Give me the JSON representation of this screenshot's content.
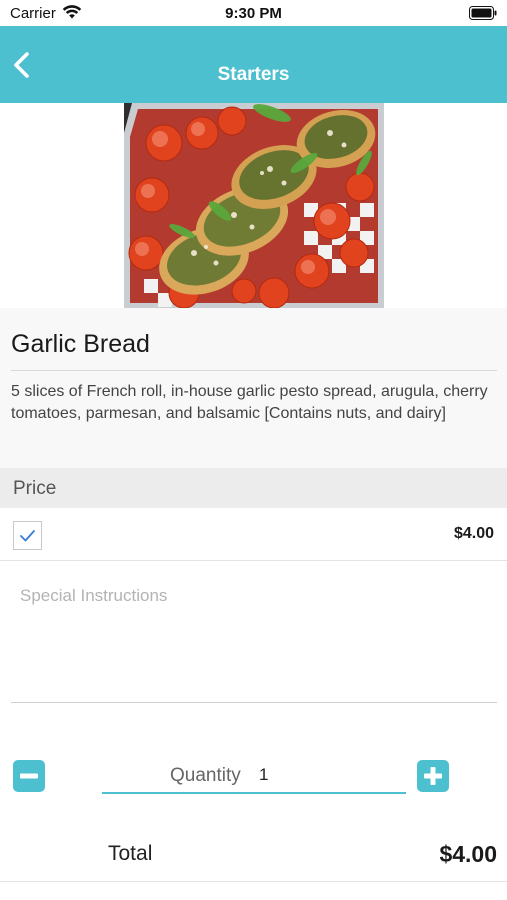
{
  "status_bar": {
    "carrier": "Carrier",
    "time": "9:30 PM"
  },
  "nav": {
    "title": "Starters",
    "back_icon": "chevron-left-icon"
  },
  "item": {
    "name": "Garlic Bread",
    "description": "5 slices of French roll, in-house garlic pesto spread, arugula, cherry tomatoes, parmesan, and balsamic [Contains nuts, and dairy]"
  },
  "price_section": {
    "header": "Price",
    "option_price": "$4.00",
    "option_checked": true
  },
  "instructions": {
    "placeholder": "Special Instructions",
    "value": ""
  },
  "quantity": {
    "label": "Quantity",
    "value": "1"
  },
  "total": {
    "label": "Total",
    "value": "$4.00"
  },
  "colors": {
    "accent": "#4dc0cf",
    "check": "#3a7bd5"
  }
}
